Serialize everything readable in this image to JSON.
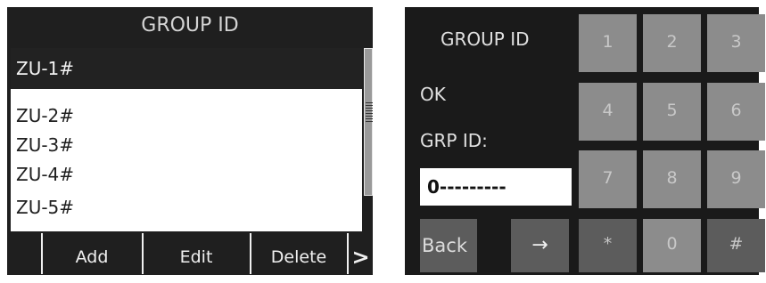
{
  "left_panel": {
    "title": "GROUP ID",
    "list": [
      "ZU-1#",
      "ZU-2#",
      "ZU-3#",
      "ZU-4#",
      "ZU-5#"
    ],
    "selected_index": 0,
    "softkeys": {
      "add": "Add",
      "edit": "Edit",
      "delete": "Delete",
      "more": ">"
    }
  },
  "right_panel": {
    "title": "GROUP ID",
    "status": "OK",
    "field_label": "GRP ID:",
    "field_value": "0---------",
    "keypad": [
      "1",
      "2",
      "3",
      "4",
      "5",
      "6",
      "7",
      "8",
      "9",
      "*",
      "0",
      "#"
    ],
    "back_label": "Back",
    "enter_label": "→"
  },
  "icons": {
    "scroll_grip": "grip-icon",
    "more": "chevron-right-icon",
    "enter": "arrow-right-icon"
  },
  "colors": {
    "panel_bg": "#1f1f1f",
    "selected_row": "#222222",
    "key_light": "#8c8c8c",
    "key_dark": "#5c5c5c"
  }
}
